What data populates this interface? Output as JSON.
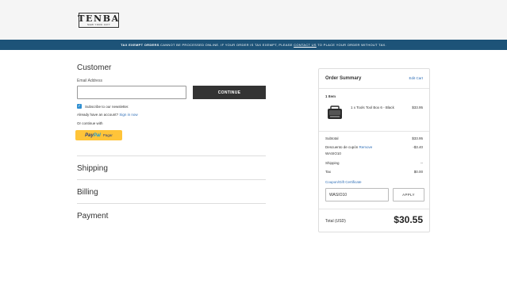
{
  "header": {
    "logo_word": "TENBA",
    "logo_sub": "NEW YORK 1977"
  },
  "banner": {
    "lead": "TAX EXEMPT ORDERS",
    "middle": " CANNOT BE PROCESSED ONLINE. IF YOUR ORDER IS TAX EXEMPT, PLEASE ",
    "link": "CONTACT US",
    "tail": " TO PLACE YOUR ORDER WITHOUT TAX."
  },
  "customer": {
    "title": "Customer",
    "email_label": "Email Address",
    "email_value": "",
    "continue_label": "CONTINUE",
    "newsletter_label": "Subscribe to our newsletter.",
    "account_prompt": "Already have an account?",
    "sign_in_label": "Sign in now",
    "or_continue": "Or continue with",
    "paypal": {
      "pay": "Pay",
      "pal": "Pal",
      "pagar": "Pagar"
    }
  },
  "steps": {
    "shipping": "Shipping",
    "billing": "Billing",
    "payment": "Payment"
  },
  "summary": {
    "title": "Order Summary",
    "edit_label": "Edit Cart",
    "items_count": "1 Item",
    "product_name": "1 x Tools Tool Box 6 - Black",
    "product_price": "$33.95",
    "subtotal_label": "Subtotal",
    "subtotal_value": "$33.95",
    "discount_label": "Descuento de cupón",
    "discount_remove": "Remove",
    "discount_value": "-$3.40",
    "discount_code": "WASIO10",
    "shipping_label": "Shipping",
    "shipping_value": "--",
    "tax_label": "Tax",
    "tax_value": "$0.00",
    "coupon_link": "Coupon/Gift Certificate",
    "coupon_value": "WASIO10",
    "apply_label": "APPLY",
    "total_label": "Total (USD)",
    "total_value": "$30.55"
  }
}
